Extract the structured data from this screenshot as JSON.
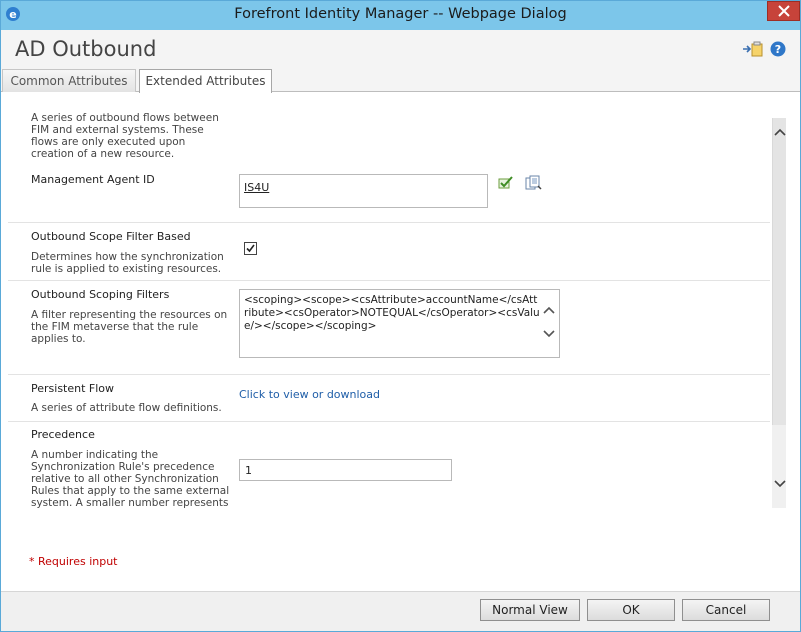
{
  "window": {
    "title": "Forefront Identity Manager -- Webpage Dialog"
  },
  "header": {
    "title": "AD Outbound"
  },
  "tabs": [
    {
      "label": "Common Attributes"
    },
    {
      "label": "Extended Attributes"
    }
  ],
  "fields": {
    "outbound_flow_desc": "A series of outbound flows between FIM and external systems. These flows are only executed upon creation of a new resource.",
    "management_agent": {
      "label": "Management Agent ID",
      "value": "IS4U"
    },
    "scope_filter_based": {
      "label": "Outbound Scope Filter Based",
      "desc": "Determines how the synchronization rule is applied to existing resources.",
      "checked": true
    },
    "scoping_filters": {
      "label": "Outbound Scoping Filters",
      "desc": "A filter representing the resources on the FIM metaverse that the rule applies to.",
      "value": "<scoping><scope><csAttribute>accountName</csAttribute><csOperator>NOTEQUAL</csOperator><csValue/></scope></scoping>"
    },
    "persistent_flow": {
      "label": "Persistent Flow",
      "desc": "A series of attribute flow definitions.",
      "link": "Click to view or download"
    },
    "precedence": {
      "label": "Precedence",
      "desc": "A number indicating the Synchronization Rule's precedence relative to all other Synchronization Rules that apply to the same external system. A smaller number represents",
      "value": "1"
    }
  },
  "required_note": "* Requires input",
  "buttons": {
    "normal_view": "Normal View",
    "ok": "OK",
    "cancel": "Cancel"
  }
}
